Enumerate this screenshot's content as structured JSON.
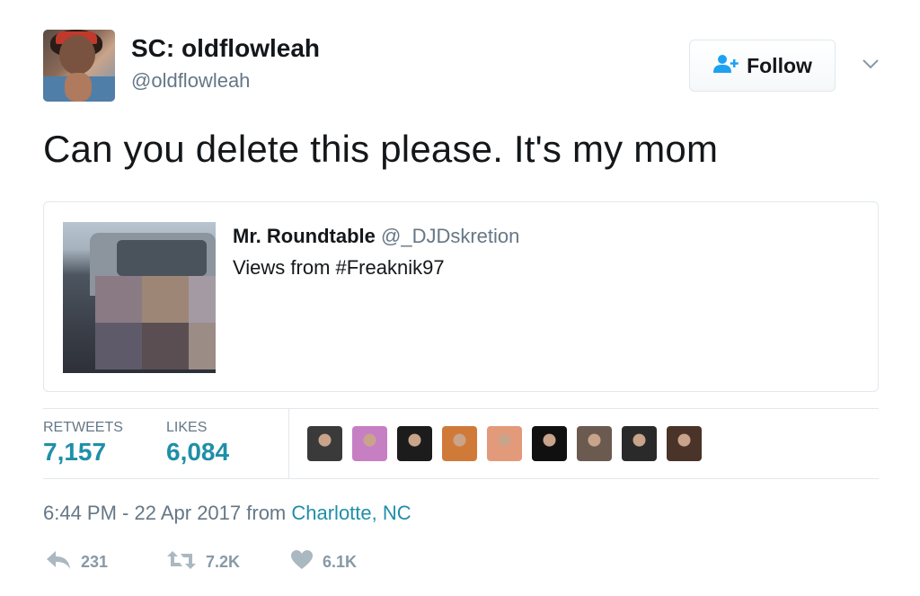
{
  "author": {
    "display_name": "SC: oldflowleah",
    "handle": "@oldflowleah"
  },
  "follow_button": {
    "label": "Follow"
  },
  "tweet": {
    "text": "Can you delete this please. It's my mom"
  },
  "quoted_tweet": {
    "name": "Mr. Roundtable",
    "handle": "@_DJDskretion",
    "text": "Views from #Freaknik97"
  },
  "stats": {
    "retweets_label": "RETWEETS",
    "retweets_value": "7,157",
    "likes_label": "LIKES",
    "likes_value": "6,084"
  },
  "likers": [
    {
      "icon": "liker-avatar-1",
      "color": "#3a3a3a"
    },
    {
      "icon": "liker-avatar-2",
      "color": "#c77fc4"
    },
    {
      "icon": "liker-avatar-3",
      "color": "#1c1c1c"
    },
    {
      "icon": "liker-avatar-4",
      "color": "#d07a3a"
    },
    {
      "icon": "liker-avatar-5",
      "color": "#e39a7a"
    },
    {
      "icon": "liker-avatar-6",
      "color": "#101010"
    },
    {
      "icon": "liker-avatar-7",
      "color": "#6b5a50"
    },
    {
      "icon": "liker-avatar-8",
      "color": "#2a2a2a"
    },
    {
      "icon": "liker-avatar-9",
      "color": "#4a3328"
    }
  ],
  "timestamp": {
    "text": "6:44 PM - 22 Apr 2017 from ",
    "location": "Charlotte, NC"
  },
  "actions": {
    "reply_count": "231",
    "retweet_count": "7.2K",
    "like_count": "6.1K"
  },
  "colors": {
    "accent": "#1f8fa8",
    "muted": "#657786",
    "border": "#e1e8ed",
    "follow_icon": "#1da1f2"
  }
}
